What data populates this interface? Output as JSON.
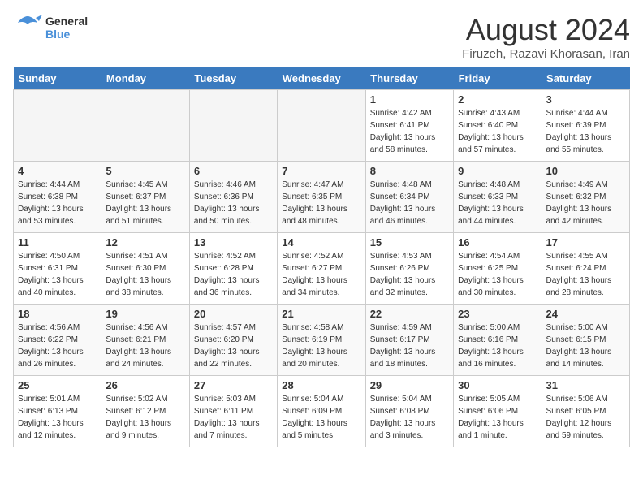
{
  "header": {
    "logo_line1": "General",
    "logo_line2": "Blue",
    "month_year": "August 2024",
    "location": "Firuzeh, Razavi Khorasan, Iran"
  },
  "days_of_week": [
    "Sunday",
    "Monday",
    "Tuesday",
    "Wednesday",
    "Thursday",
    "Friday",
    "Saturday"
  ],
  "weeks": [
    [
      {
        "day": "",
        "empty": true
      },
      {
        "day": "",
        "empty": true
      },
      {
        "day": "",
        "empty": true
      },
      {
        "day": "",
        "empty": true
      },
      {
        "day": "1",
        "sunrise": "4:42 AM",
        "sunset": "6:41 PM",
        "daylight": "13 hours and 58 minutes."
      },
      {
        "day": "2",
        "sunrise": "4:43 AM",
        "sunset": "6:40 PM",
        "daylight": "13 hours and 57 minutes."
      },
      {
        "day": "3",
        "sunrise": "4:44 AM",
        "sunset": "6:39 PM",
        "daylight": "13 hours and 55 minutes."
      }
    ],
    [
      {
        "day": "4",
        "sunrise": "4:44 AM",
        "sunset": "6:38 PM",
        "daylight": "13 hours and 53 minutes."
      },
      {
        "day": "5",
        "sunrise": "4:45 AM",
        "sunset": "6:37 PM",
        "daylight": "13 hours and 51 minutes."
      },
      {
        "day": "6",
        "sunrise": "4:46 AM",
        "sunset": "6:36 PM",
        "daylight": "13 hours and 50 minutes."
      },
      {
        "day": "7",
        "sunrise": "4:47 AM",
        "sunset": "6:35 PM",
        "daylight": "13 hours and 48 minutes."
      },
      {
        "day": "8",
        "sunrise": "4:48 AM",
        "sunset": "6:34 PM",
        "daylight": "13 hours and 46 minutes."
      },
      {
        "day": "9",
        "sunrise": "4:48 AM",
        "sunset": "6:33 PM",
        "daylight": "13 hours and 44 minutes."
      },
      {
        "day": "10",
        "sunrise": "4:49 AM",
        "sunset": "6:32 PM",
        "daylight": "13 hours and 42 minutes."
      }
    ],
    [
      {
        "day": "11",
        "sunrise": "4:50 AM",
        "sunset": "6:31 PM",
        "daylight": "13 hours and 40 minutes."
      },
      {
        "day": "12",
        "sunrise": "4:51 AM",
        "sunset": "6:30 PM",
        "daylight": "13 hours and 38 minutes."
      },
      {
        "day": "13",
        "sunrise": "4:52 AM",
        "sunset": "6:28 PM",
        "daylight": "13 hours and 36 minutes."
      },
      {
        "day": "14",
        "sunrise": "4:52 AM",
        "sunset": "6:27 PM",
        "daylight": "13 hours and 34 minutes."
      },
      {
        "day": "15",
        "sunrise": "4:53 AM",
        "sunset": "6:26 PM",
        "daylight": "13 hours and 32 minutes."
      },
      {
        "day": "16",
        "sunrise": "4:54 AM",
        "sunset": "6:25 PM",
        "daylight": "13 hours and 30 minutes."
      },
      {
        "day": "17",
        "sunrise": "4:55 AM",
        "sunset": "6:24 PM",
        "daylight": "13 hours and 28 minutes."
      }
    ],
    [
      {
        "day": "18",
        "sunrise": "4:56 AM",
        "sunset": "6:22 PM",
        "daylight": "13 hours and 26 minutes."
      },
      {
        "day": "19",
        "sunrise": "4:56 AM",
        "sunset": "6:21 PM",
        "daylight": "13 hours and 24 minutes."
      },
      {
        "day": "20",
        "sunrise": "4:57 AM",
        "sunset": "6:20 PM",
        "daylight": "13 hours and 22 minutes."
      },
      {
        "day": "21",
        "sunrise": "4:58 AM",
        "sunset": "6:19 PM",
        "daylight": "13 hours and 20 minutes."
      },
      {
        "day": "22",
        "sunrise": "4:59 AM",
        "sunset": "6:17 PM",
        "daylight": "13 hours and 18 minutes."
      },
      {
        "day": "23",
        "sunrise": "5:00 AM",
        "sunset": "6:16 PM",
        "daylight": "13 hours and 16 minutes."
      },
      {
        "day": "24",
        "sunrise": "5:00 AM",
        "sunset": "6:15 PM",
        "daylight": "13 hours and 14 minutes."
      }
    ],
    [
      {
        "day": "25",
        "sunrise": "5:01 AM",
        "sunset": "6:13 PM",
        "daylight": "13 hours and 12 minutes."
      },
      {
        "day": "26",
        "sunrise": "5:02 AM",
        "sunset": "6:12 PM",
        "daylight": "13 hours and 9 minutes."
      },
      {
        "day": "27",
        "sunrise": "5:03 AM",
        "sunset": "6:11 PM",
        "daylight": "13 hours and 7 minutes."
      },
      {
        "day": "28",
        "sunrise": "5:04 AM",
        "sunset": "6:09 PM",
        "daylight": "13 hours and 5 minutes."
      },
      {
        "day": "29",
        "sunrise": "5:04 AM",
        "sunset": "6:08 PM",
        "daylight": "13 hours and 3 minutes."
      },
      {
        "day": "30",
        "sunrise": "5:05 AM",
        "sunset": "6:06 PM",
        "daylight": "13 hours and 1 minute."
      },
      {
        "day": "31",
        "sunrise": "5:06 AM",
        "sunset": "6:05 PM",
        "daylight": "12 hours and 59 minutes."
      }
    ]
  ]
}
